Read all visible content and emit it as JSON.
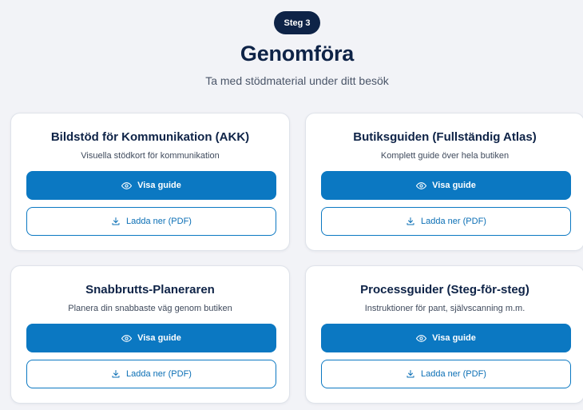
{
  "step": {
    "badge": "Steg 3"
  },
  "header": {
    "title": "Genomföra",
    "subtitle": "Ta med stödmaterial under ditt besök"
  },
  "cards": [
    {
      "title": "Bildstöd för Kommunikation (AKK)",
      "description": "Visuella stödkort för kommunikation",
      "view_label": "Visa guide",
      "download_label": "Ladda ner (PDF)"
    },
    {
      "title": "Butiksguiden (Fullständig Atlas)",
      "description": "Komplett guide över hela butiken",
      "view_label": "Visa guide",
      "download_label": "Ladda ner (PDF)"
    },
    {
      "title": "Snabbrutts-Planeraren",
      "description": "Planera din snabbaste väg genom butiken",
      "view_label": "Visa guide",
      "download_label": "Ladda ner (PDF)"
    },
    {
      "title": "Processguider (Steg-för-steg)",
      "description": "Instruktioner för pant, självscanning m.m.",
      "view_label": "Visa guide",
      "download_label": "Ladda ner (PDF)"
    }
  ],
  "icons": {
    "view": "eye-icon",
    "download": "download-icon"
  },
  "colors": {
    "background": "#f2f3f7",
    "badge": "#0e2347",
    "primary": "#0b78c2",
    "title": "#0e2347"
  }
}
